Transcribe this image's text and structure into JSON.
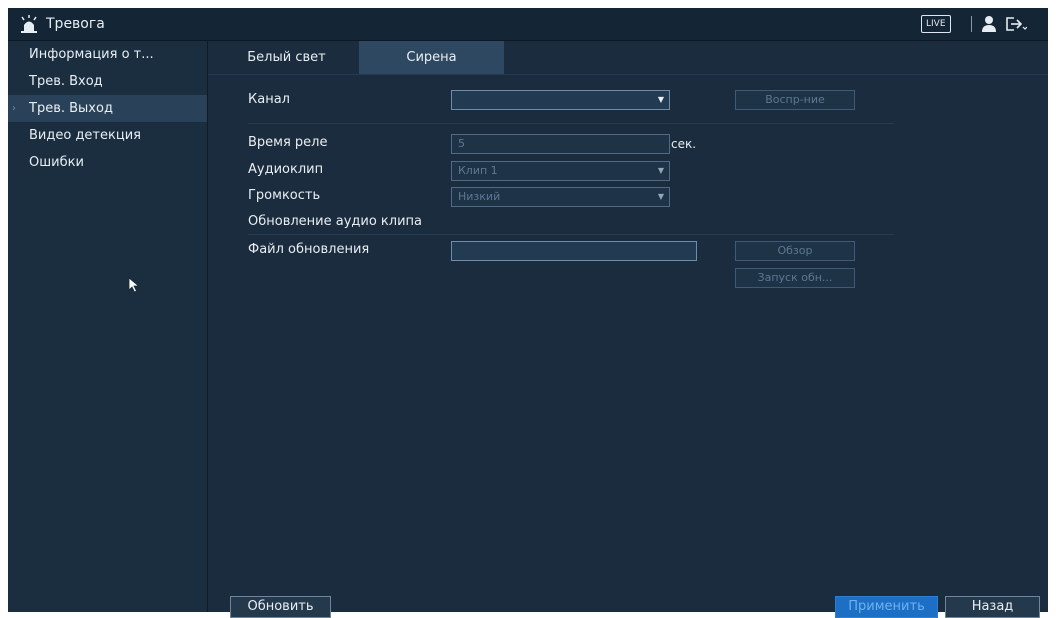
{
  "window": {
    "title": "Тревога",
    "live_label": "LIVE"
  },
  "sidebar": {
    "items": [
      {
        "label": "Информация о т...",
        "active": false
      },
      {
        "label": "Трев. Вход",
        "active": false
      },
      {
        "label": "Трев. Выход",
        "active": true
      },
      {
        "label": "Видео детекция",
        "active": false
      },
      {
        "label": "Ошибки",
        "active": false
      }
    ]
  },
  "tabs": [
    {
      "label": "Белый свет",
      "active": false
    },
    {
      "label": "Сирена",
      "active": true
    }
  ],
  "form": {
    "channel_label": "Канал",
    "channel_value": "",
    "play_button": "Воспр-ние",
    "relay_time_label": "Время реле",
    "relay_time_value": "5",
    "relay_time_unit": "сек.",
    "audioclip_label": "Аудиоклип",
    "audioclip_value": "Клип 1",
    "volume_label": "Громкость",
    "volume_value": "Низкий",
    "update_section_title": "Обновление аудио клипа",
    "update_file_label": "Файл обновления",
    "update_file_value": "",
    "browse_button": "Обзор",
    "start_update_button": "Запуск обн..."
  },
  "footer": {
    "refresh_button": "Обновить",
    "apply_button": "Применить",
    "back_button": "Назад"
  }
}
